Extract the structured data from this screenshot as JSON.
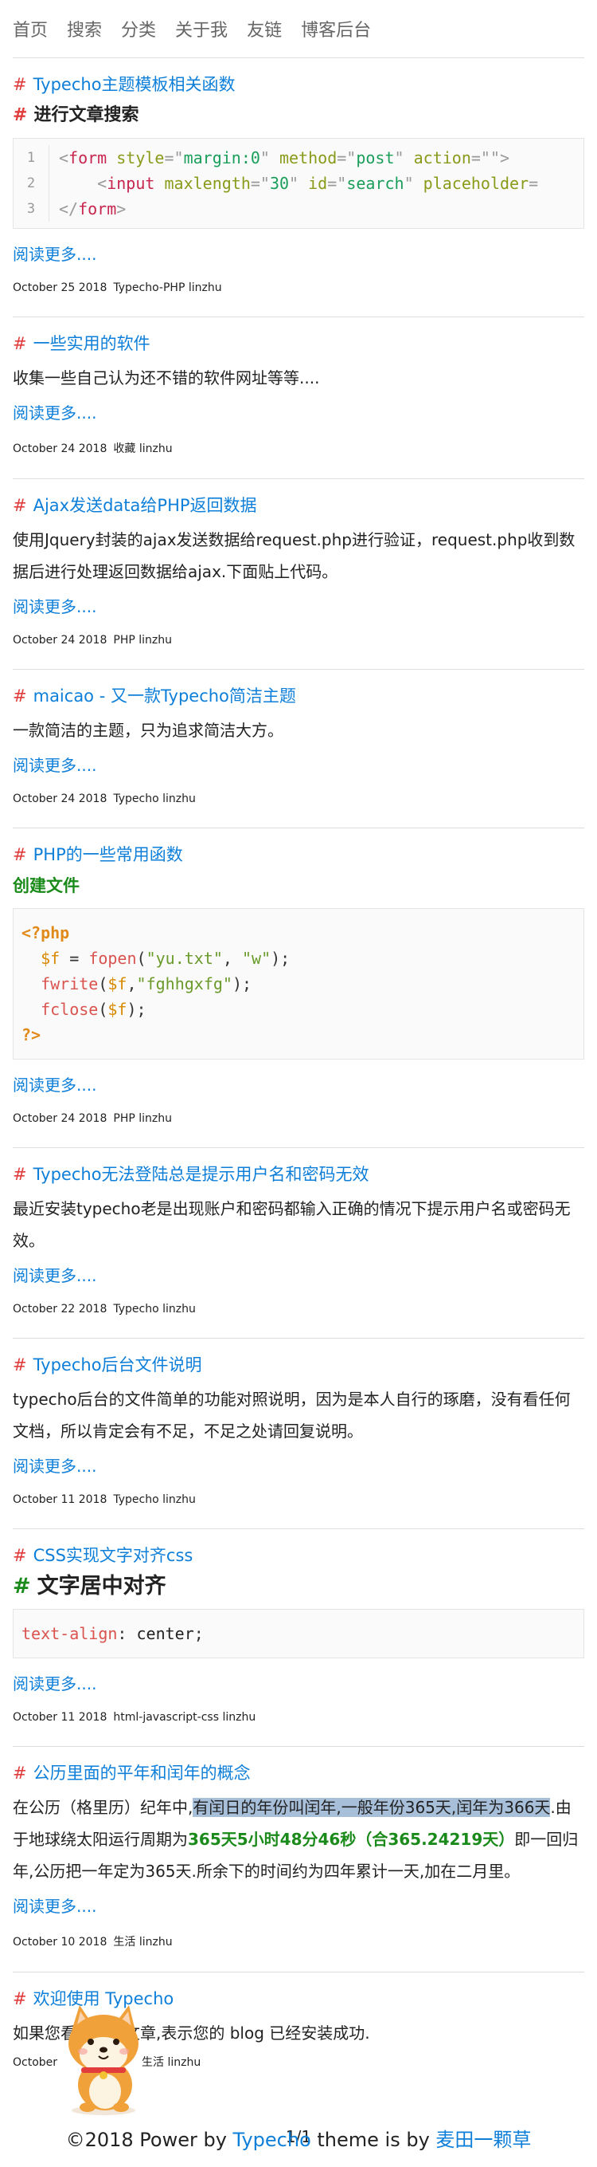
{
  "nav": [
    "首页",
    "搜索",
    "分类",
    "关于我",
    "友链",
    "博客后台"
  ],
  "hash": "#",
  "posts": [
    {
      "title": "Typecho主题模板相关函数",
      "subheading": "进行文章搜索",
      "code_lines": [
        "1",
        "2",
        "3"
      ],
      "readmore": "阅读更多....",
      "date": "October 25 2018",
      "category": "Typecho-PHP",
      "author": "linzhu"
    },
    {
      "title": "一些实用的软件",
      "excerpt": "收集一些自己认为还不错的软件网址等等....",
      "readmore": "阅读更多....",
      "date": "October 24 2018",
      "category": "收藏",
      "author": "linzhu"
    },
    {
      "title": "Ajax发送data给PHP返回数据",
      "excerpt": "使用Jquery封装的ajax发送数据给request.php进行验证，request.php收到数据后进行处理返回数据给ajax.下面贴上代码。",
      "readmore": "阅读更多....",
      "date": "October 24 2018",
      "category": "PHP",
      "author": "linzhu"
    },
    {
      "title": "maicao - 又一款Typecho简洁主题",
      "excerpt": "一款简洁的主题，只为追求简洁大方。",
      "readmore": "阅读更多....",
      "date": "October 24 2018",
      "category": "Typecho",
      "author": "linzhu"
    },
    {
      "title": "PHP的一些常用函数",
      "subheading": "创建文件",
      "readmore": "阅读更多....",
      "date": "October 24 2018",
      "category": "PHP",
      "author": "linzhu"
    },
    {
      "title": "Typecho无法登陆总是提示用户名和密码无效",
      "excerpt": "最近安装typecho老是出现账户和密码都输入正确的情况下提示用户名或密码无效。",
      "readmore": "阅读更多....",
      "date": "October 22 2018",
      "category": "Typecho",
      "author": "linzhu"
    },
    {
      "title": "Typecho后台文件说明",
      "excerpt": "typecho后台的文件简单的功能对照说明，因为是本人自行的琢磨，没有看任何文档，所以肯定会有不足，不足之处请回复说明。",
      "readmore": "阅读更多....",
      "date": "October 11 2018",
      "category": "Typecho",
      "author": "linzhu"
    },
    {
      "title": "CSS实现文字对齐css",
      "subheading": "文字居中对齐",
      "code_text": "text-align: center;",
      "readmore": "阅读更多....",
      "date": "October 11 2018",
      "category": "html-javascript-css",
      "author": "linzhu"
    },
    {
      "title": "公历里面的平年和闰年的概念",
      "excerpt_a": "在公历（格里历）纪年中,",
      "excerpt_hl": "有闰日的年份叫闰年,一般年份365天,闰年为366天",
      "excerpt_b": ".由于地球绕太阳运行周期为",
      "excerpt_green": "365天5小时48分46秒（合365.24219天）",
      "excerpt_c": "即一回归年,公历把一年定为365天.所余下的时间约为四年累计一天,加在二月里。",
      "readmore": "阅读更多....",
      "date": "October 10 2018",
      "category": "生活",
      "author": "linzhu"
    },
    {
      "title": "欢迎使用 Typecho",
      "excerpt": "如果您看到这篇文章,表示您的 blog 已经安装成功.",
      "date": "October",
      "category": "生活",
      "author": "linzhu"
    }
  ],
  "pager": "1/1",
  "footer": {
    "prefix": "©2018 Power by ",
    "typecho": "Typecho",
    "middle": " theme is by ",
    "author": "麦田一颗草"
  }
}
